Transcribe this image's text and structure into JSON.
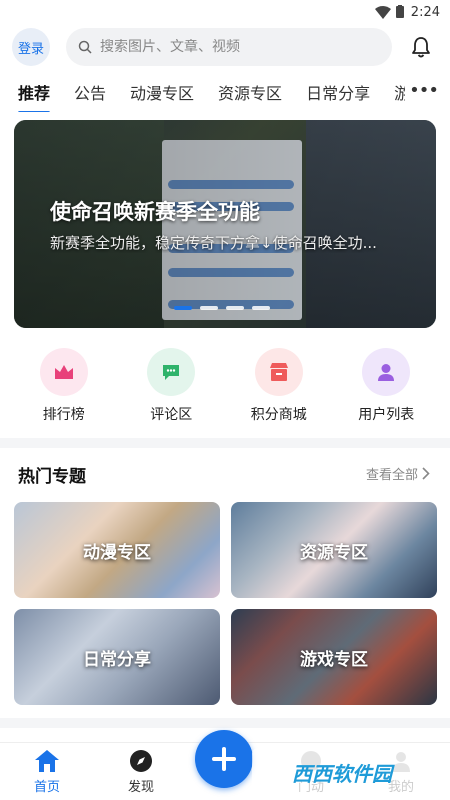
{
  "status_bar": {
    "time": "2:24"
  },
  "header": {
    "login_label": "登录",
    "search_placeholder": "搜索图片、文章、视频"
  },
  "tabs": [
    "推荐",
    "公告",
    "动漫专区",
    "资源专区",
    "日常分享",
    "游"
  ],
  "banner": {
    "title": "使命召唤新赛季全功能",
    "subtitle": "新赛季全功能，稳定传奇下方拿↓使命召唤全功..."
  },
  "quick_entries": [
    {
      "label": "排行榜",
      "icon": "crown-icon",
      "bg": "#fde7ef",
      "color": "#e8417a"
    },
    {
      "label": "评论区",
      "icon": "comment-icon",
      "bg": "#e3f5ec",
      "color": "#2fb36b"
    },
    {
      "label": "积分商城",
      "icon": "store-icon",
      "bg": "#fde7e7",
      "color": "#ef5b5b"
    },
    {
      "label": "用户列表",
      "icon": "user-icon",
      "bg": "#efe6fb",
      "color": "#9a5fe0"
    }
  ],
  "hot_topics": {
    "title": "热门专题",
    "see_all": "查看全部",
    "items": [
      "动漫专区",
      "资源专区",
      "日常分享",
      "游戏专区"
    ]
  },
  "bottom_nav": {
    "home": "首页",
    "discover": "发现",
    "message": "门动",
    "me": "我的"
  },
  "watermark": "西西软件园",
  "colors": {
    "accent": "#1a73e8"
  }
}
